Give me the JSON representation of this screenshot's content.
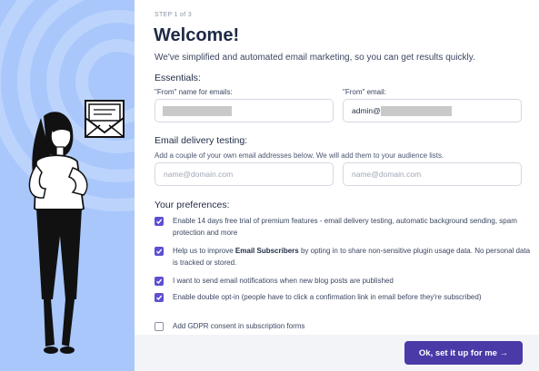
{
  "header": {
    "step": "STEP 1 of 3",
    "title": "Welcome!",
    "subtitle": "We've simplified and automated email marketing, so you can get results quickly."
  },
  "essentials": {
    "label": "Essentials:",
    "from_name_label": "\"From\" name for emails:",
    "from_email_label": "\"From\" email:",
    "from_email_value": "admin@"
  },
  "testing": {
    "label": "Email delivery testing:",
    "hint": "Add a couple of your own email addresses below. We will add them to your audience lists.",
    "email1_placeholder": "name@domain.com",
    "email2_placeholder": "name@domain.com"
  },
  "preferences": {
    "label": "Your preferences:",
    "items": [
      {
        "checked": true,
        "text": "Enable 14 days free trial of premium features - email delivery testing, automatic background sending, spam protection and more"
      },
      {
        "checked": true,
        "prefix": "Help us to improve ",
        "bold": "Email Subscribers",
        "suffix": " by opting in to share non-sensitive plugin usage data. No personal data is tracked or stored."
      },
      {
        "checked": true,
        "text": "I want to send email notifications when new blog posts are published"
      },
      {
        "checked": true,
        "text": "Enable double opt-in (people have to click a confirmation link in email before they're subscribed)"
      },
      {
        "checked": false,
        "text": "Add GDPR consent in subscription forms"
      }
    ]
  },
  "footer": {
    "submit_label": "Ok, set it up for me →"
  },
  "colors": {
    "accent": "#5d4fd2",
    "button": "#4a3aa8",
    "left_panel": "#a9c7fb"
  },
  "icons": [
    "envelope-letter-icon",
    "checkbox-checked-icon",
    "checkbox-empty-icon"
  ]
}
